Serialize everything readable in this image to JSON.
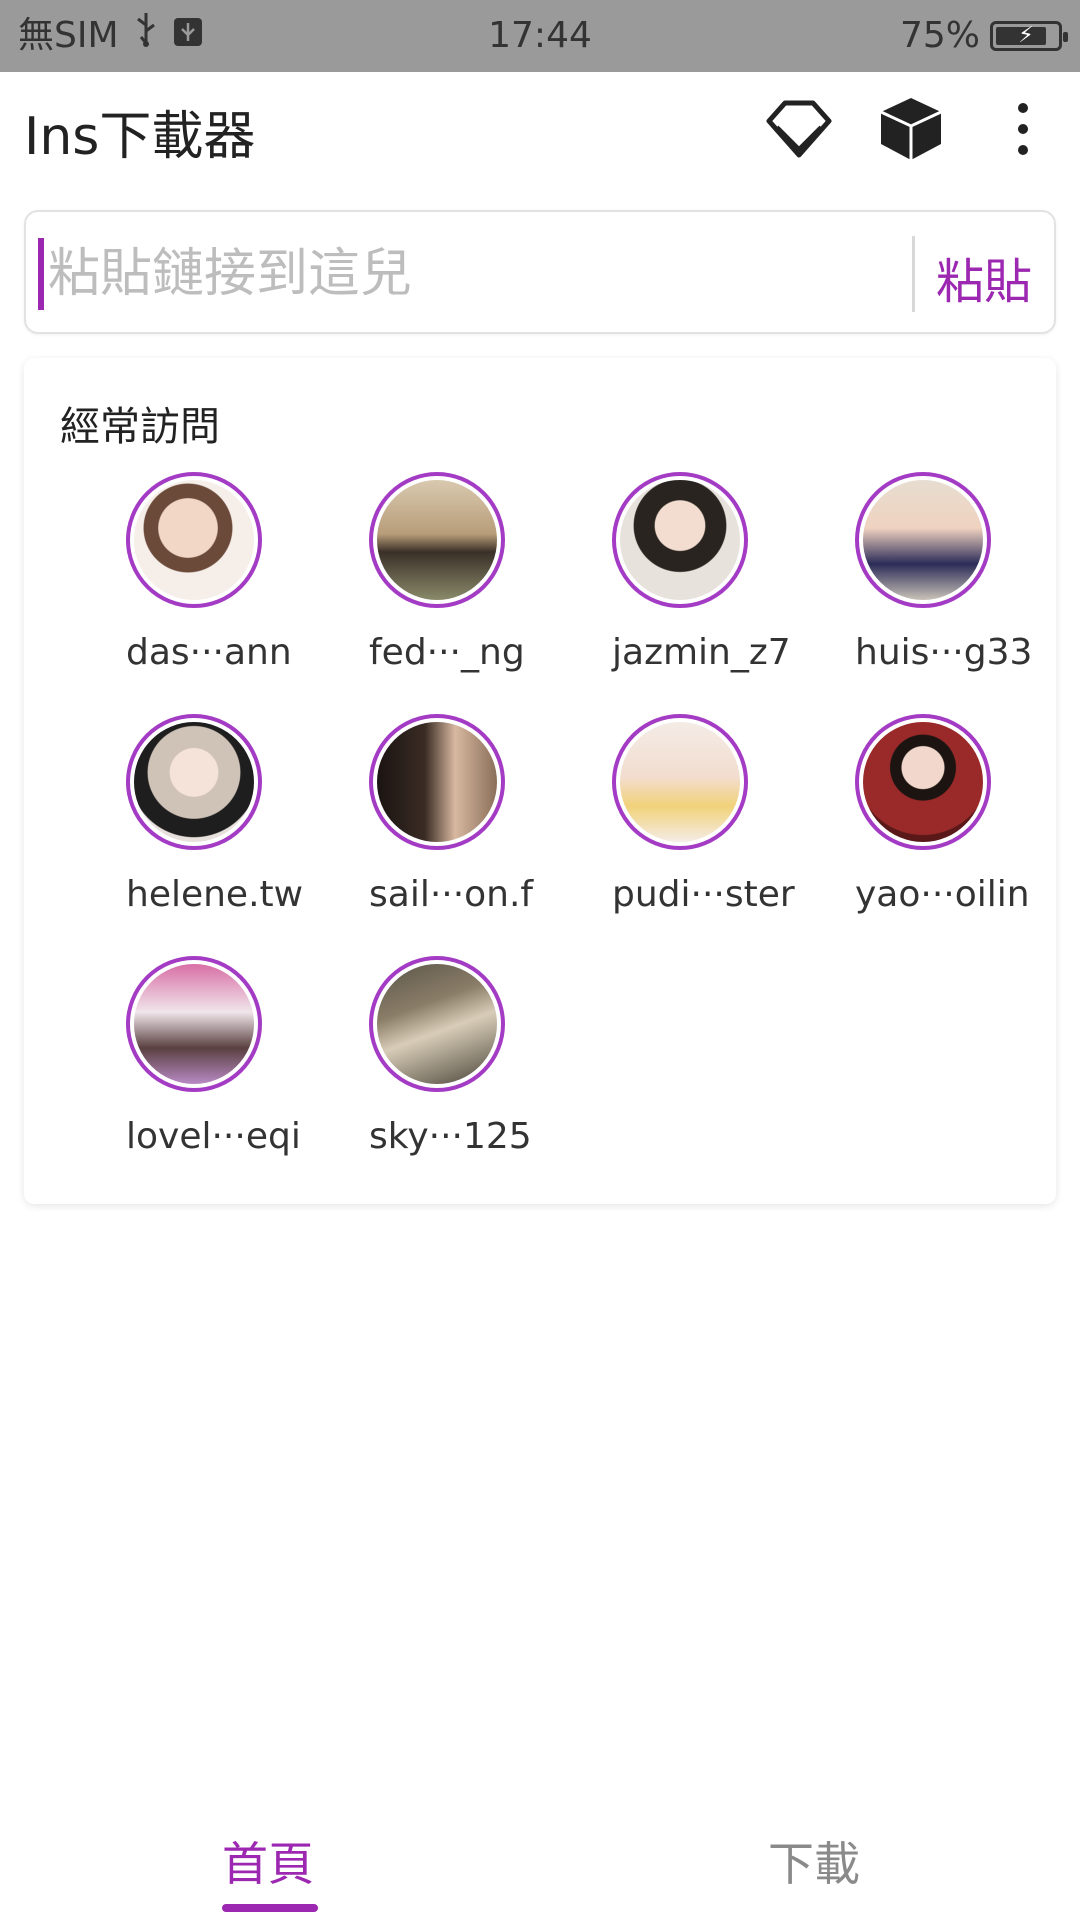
{
  "status_bar": {
    "carrier": "無SIM",
    "time": "17:44",
    "battery": "75%"
  },
  "app_bar": {
    "title": "Ins下載器",
    "icons": [
      "diamond-icon",
      "cube-icon",
      "more-vert-icon"
    ]
  },
  "search": {
    "placeholder": "粘貼鏈接到這兒",
    "value": "",
    "paste_label": "粘貼"
  },
  "frequent": {
    "title": "經常訪問",
    "users": [
      {
        "name": "das···ann",
        "color": "#e8c4b4"
      },
      {
        "name": "fed···_ng",
        "color": "#b49a7a"
      },
      {
        "name": "jazmin_z7",
        "color": "#d8cfc8"
      },
      {
        "name": "huis···g33",
        "color": "#9aa0c4"
      },
      {
        "name": "helene.tw",
        "color": "#cfc3b8"
      },
      {
        "name": "sail···on.f",
        "color": "#5a4a3e"
      },
      {
        "name": "pudi···ster",
        "color": "#f1d27a"
      },
      {
        "name": "yao···oilin",
        "color": "#9a2a2a"
      },
      {
        "name": "lovel···eqi",
        "color": "#d86fa6"
      },
      {
        "name": "sky···125",
        "color": "#7d7563"
      }
    ]
  },
  "bottom_nav": {
    "tabs": [
      {
        "label": "首頁",
        "active": true
      },
      {
        "label": "下載",
        "active": false
      }
    ]
  },
  "colors": {
    "accent": "#9c27b0",
    "avatar_ring": "#a43bc4"
  }
}
